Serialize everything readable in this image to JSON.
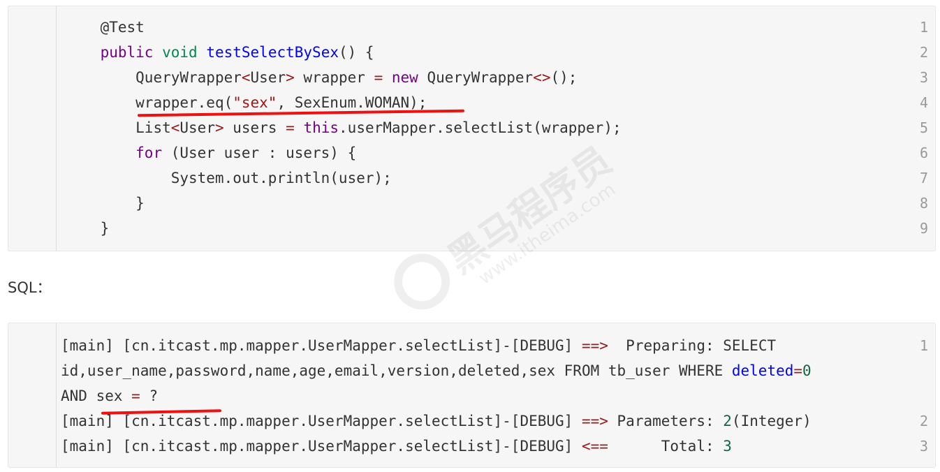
{
  "code_block_1": {
    "line_numbers": [
      "1",
      "2",
      "3",
      "4",
      "5",
      "6",
      "7",
      "8",
      "9"
    ],
    "lines": [
      {
        "indent": "    ",
        "tokens": [
          {
            "t": "@Test",
            "c": "plain"
          }
        ]
      },
      {
        "indent": "    ",
        "tokens": [
          {
            "t": "public",
            "c": "kw-purple"
          },
          {
            "t": " ",
            "c": "plain"
          },
          {
            "t": "void",
            "c": "kw-green"
          },
          {
            "t": " ",
            "c": "plain"
          },
          {
            "t": "testSelectBySex",
            "c": "fn-blue"
          },
          {
            "t": "() {",
            "c": "plain"
          }
        ]
      },
      {
        "indent": "        ",
        "tokens": [
          {
            "t": "QueryWrapper",
            "c": "plain"
          },
          {
            "t": "<",
            "c": "op"
          },
          {
            "t": "User",
            "c": "plain"
          },
          {
            "t": ">",
            "c": "op"
          },
          {
            "t": " wrapper ",
            "c": "plain"
          },
          {
            "t": "=",
            "c": "op"
          },
          {
            "t": " ",
            "c": "plain"
          },
          {
            "t": "new",
            "c": "kw-purple"
          },
          {
            "t": " QueryWrapper",
            "c": "plain"
          },
          {
            "t": "<>",
            "c": "op"
          },
          {
            "t": "();",
            "c": "plain"
          }
        ]
      },
      {
        "indent": "        ",
        "tokens": [
          {
            "t": "wrapper.eq(",
            "c": "plain"
          },
          {
            "t": "\"sex\"",
            "c": "str"
          },
          {
            "t": ", SexEnum.WOMAN);",
            "c": "plain"
          }
        ]
      },
      {
        "indent": "        ",
        "tokens": [
          {
            "t": "List",
            "c": "plain"
          },
          {
            "t": "<",
            "c": "op"
          },
          {
            "t": "User",
            "c": "plain"
          },
          {
            "t": ">",
            "c": "op"
          },
          {
            "t": " users ",
            "c": "plain"
          },
          {
            "t": "=",
            "c": "op"
          },
          {
            "t": " ",
            "c": "plain"
          },
          {
            "t": "this",
            "c": "kw-purple"
          },
          {
            "t": ".userMapper.selectList(wrapper);",
            "c": "plain"
          }
        ]
      },
      {
        "indent": "        ",
        "tokens": [
          {
            "t": "for",
            "c": "kw-purple"
          },
          {
            "t": " (User user : users) {",
            "c": "plain"
          }
        ]
      },
      {
        "indent": "            ",
        "tokens": [
          {
            "t": "System.out.println(user);",
            "c": "plain"
          }
        ]
      },
      {
        "indent": "        ",
        "tokens": [
          {
            "t": "}",
            "c": "plain"
          }
        ]
      },
      {
        "indent": "    ",
        "tokens": [
          {
            "t": "}",
            "c": "plain"
          }
        ]
      }
    ]
  },
  "sql_label": "SQL：",
  "code_block_2": {
    "line_numbers": [
      "1",
      "",
      "",
      "2",
      "3"
    ],
    "lines": [
      {
        "indent": "",
        "tokens": [
          {
            "t": "[main] [cn.itcast.mp.mapper.UserMapper.selectList]-[DEBUG] ",
            "c": "plain"
          },
          {
            "t": "==>",
            "c": "op"
          },
          {
            "t": "  Preparing: SELECT",
            "c": "plain"
          }
        ]
      },
      {
        "indent": "",
        "tokens": [
          {
            "t": "id,user_name,password,name,age,email,version,deleted,sex FROM tb_user WHERE ",
            "c": "plain"
          },
          {
            "t": "deleted",
            "c": "var-blue"
          },
          {
            "t": "=",
            "c": "op"
          },
          {
            "t": "0",
            "c": "num"
          }
        ]
      },
      {
        "indent": "",
        "tokens": [
          {
            "t": "AND sex ",
            "c": "plain"
          },
          {
            "t": "=",
            "c": "op"
          },
          {
            "t": " ?",
            "c": "plain"
          }
        ]
      },
      {
        "indent": "",
        "tokens": [
          {
            "t": "[main] [cn.itcast.mp.mapper.UserMapper.selectList]-[DEBUG] ",
            "c": "plain"
          },
          {
            "t": "==>",
            "c": "op"
          },
          {
            "t": " Parameters: ",
            "c": "plain"
          },
          {
            "t": "2",
            "c": "num"
          },
          {
            "t": "(Integer)",
            "c": "plain"
          }
        ]
      },
      {
        "indent": "",
        "tokens": [
          {
            "t": "[main] [cn.itcast.mp.mapper.UserMapper.selectList]-[DEBUG] ",
            "c": "plain"
          },
          {
            "t": "<==",
            "c": "op"
          },
          {
            "t": "      Total: ",
            "c": "plain"
          },
          {
            "t": "3",
            "c": "num"
          }
        ]
      }
    ]
  },
  "watermark": {
    "main": "黑马程序员",
    "sub": "www.itheima.com"
  },
  "colors": {
    "background": "#ffffff",
    "code_bg": "#f6f6f6",
    "keyword": "#770088",
    "type_keyword": "#008855",
    "function": "#0000ff",
    "string": "#aa1111",
    "operator": "#981a1a",
    "number": "#116644",
    "annotation": "#ee1111"
  }
}
